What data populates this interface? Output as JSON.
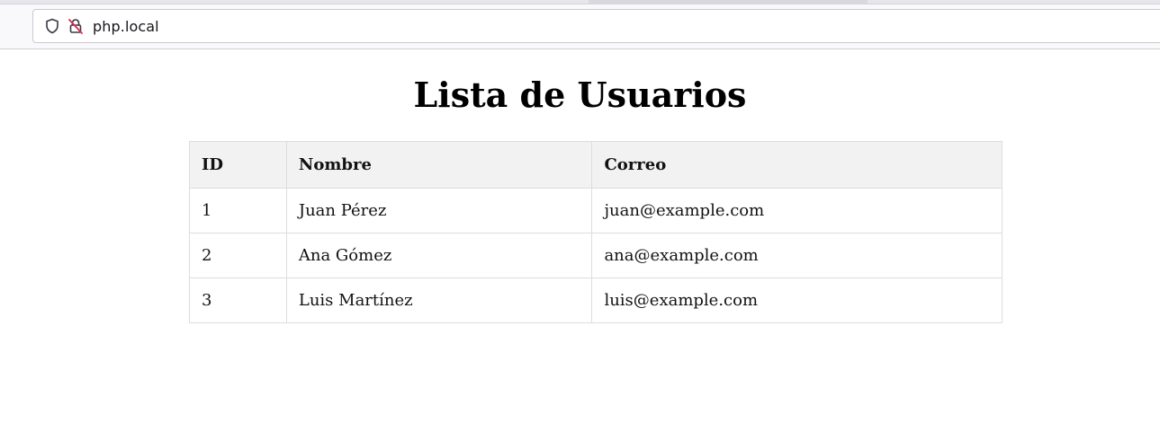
{
  "browser": {
    "url": "php.local",
    "icons": [
      "shield-icon",
      "insecure-lock-icon"
    ]
  },
  "page": {
    "title": "Lista de Usuarios",
    "table": {
      "headers": [
        "ID",
        "Nombre",
        "Correo"
      ],
      "rows": [
        [
          "1",
          "Juan Pérez",
          "juan@example.com"
        ],
        [
          "2",
          "Ana Gómez",
          "ana@example.com"
        ],
        [
          "3",
          "Luis Martínez",
          "luis@example.com"
        ]
      ]
    }
  },
  "colors": {
    "header_bg": "#f2f2f2",
    "border": "#dddddd",
    "insecure_icon": "#e22850"
  }
}
